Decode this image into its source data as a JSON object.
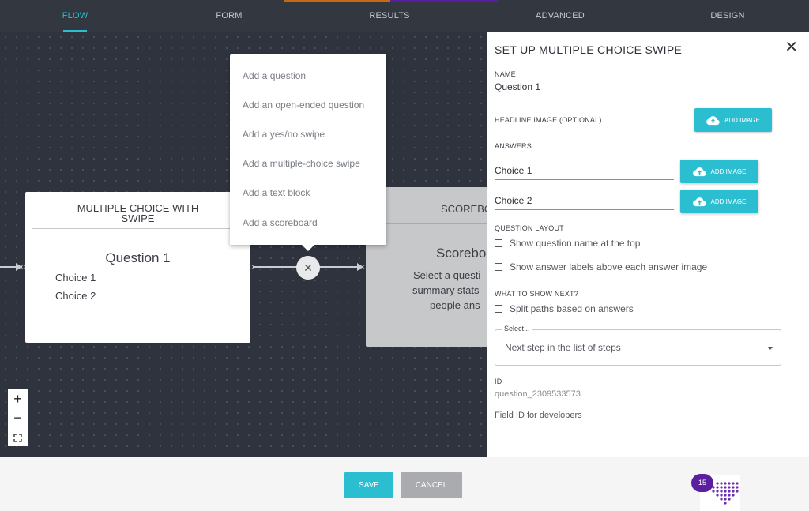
{
  "tabs": [
    {
      "label": "FLOW",
      "active": true
    },
    {
      "label": "FORM",
      "active": false
    },
    {
      "label": "RESULTS",
      "active": false
    },
    {
      "label": "ADVANCED",
      "active": false
    },
    {
      "label": "DESIGN",
      "active": false
    }
  ],
  "colors": {
    "accent": "#2bbed0",
    "tab_bar_top_orange": "#c46a12",
    "tab_bar_top_purple": "#5a1fa0",
    "badge": "#5a1fa0"
  },
  "canvas": {
    "question_card": {
      "header": "MULTIPLE CHOICE WITH SWIPE",
      "title": "Question 1",
      "choices": [
        "Choice 1",
        "Choice 2"
      ]
    },
    "scoreboard_card": {
      "header": "SCOREBO",
      "title": "Scorebo",
      "description_lines": [
        "Select a questi",
        "summary stats",
        "people ans"
      ]
    },
    "insert_button_icon": "close-icon",
    "add_menu": [
      "Add a question",
      "Add an open-ended question",
      "Add a yes/no swipe",
      "Add a multiple-choice swipe",
      "Add a text block",
      "Add a scoreboard"
    ],
    "zoom": {
      "in": "+",
      "out": "−",
      "fit": "fit-screen-icon"
    }
  },
  "panel": {
    "title": "SET UP MULTIPLE CHOICE SWIPE",
    "close_icon": "close-icon",
    "name_label": "NAME",
    "name_value": "Question 1",
    "headline_image_label": "HEADLINE IMAGE (OPTIONAL)",
    "add_image_label": "ADD IMAGE",
    "answers_label": "ANSWERS",
    "answers": [
      "Choice 1",
      "Choice 2"
    ],
    "question_layout_label": "QUESTION LAYOUT",
    "layout_options": [
      "Show question name at the top",
      "Show answer labels above each answer image"
    ],
    "what_next_label": "WHAT TO SHOW NEXT?",
    "split_paths_label": "Split paths based on answers",
    "select_legend": "Select...",
    "select_value": "Next step in the list of steps",
    "id_label": "ID",
    "id_value": "question_2309533573",
    "id_help": "Field ID for developers"
  },
  "footer": {
    "save_label": "SAVE",
    "cancel_label": "CANCEL",
    "badge_count": "15"
  }
}
